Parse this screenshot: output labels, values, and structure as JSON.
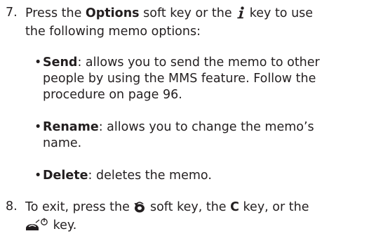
{
  "step7": {
    "number": "7.",
    "line1_a": "Press the ",
    "line1_bold": "Options",
    "line1_b": " soft key or the ",
    "line1_c": " key to use",
    "line2": "the following memo options:",
    "info_key_icon": "info-i-key-icon"
  },
  "bullets": [
    {
      "term": "Send",
      "line1": ": allows you to send the memo to other",
      "line2": "people by using the MMS feature. Follow the",
      "line3": "procedure on page 96."
    },
    {
      "term": "Rename",
      "line1": ": allows you to change the memo’s",
      "line2": "name."
    },
    {
      "term": "Delete",
      "line1": ": deletes the memo."
    }
  ],
  "step8": {
    "number": "8.",
    "line1_a": "To exit, press the ",
    "line1_b": " soft key, the ",
    "line1_key": "C",
    "line1_c": " key, or the",
    "line2": " key.",
    "back_icon": "back-arrow-icon",
    "end_key_icon": "end-power-key-icon"
  }
}
